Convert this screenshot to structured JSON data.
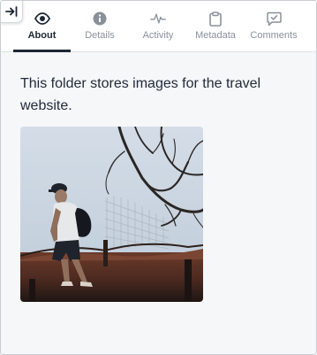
{
  "tabs": [
    {
      "label": "About",
      "icon": "eye-icon",
      "active": true
    },
    {
      "label": "Details",
      "icon": "info-icon",
      "active": false
    },
    {
      "label": "Activity",
      "icon": "activity-icon",
      "active": false
    },
    {
      "label": "Metadata",
      "icon": "clipboard-icon",
      "active": false
    },
    {
      "label": "Comments",
      "icon": "comment-check-icon",
      "active": false
    }
  ],
  "collapse_button": {
    "icon": "collapse-panel-icon"
  },
  "about": {
    "description": "This folder stores images for the travel website."
  },
  "colors": {
    "active_tab": "#1d2633",
    "inactive_tab": "#8a9099",
    "panel_background": "#f6f7f9"
  }
}
